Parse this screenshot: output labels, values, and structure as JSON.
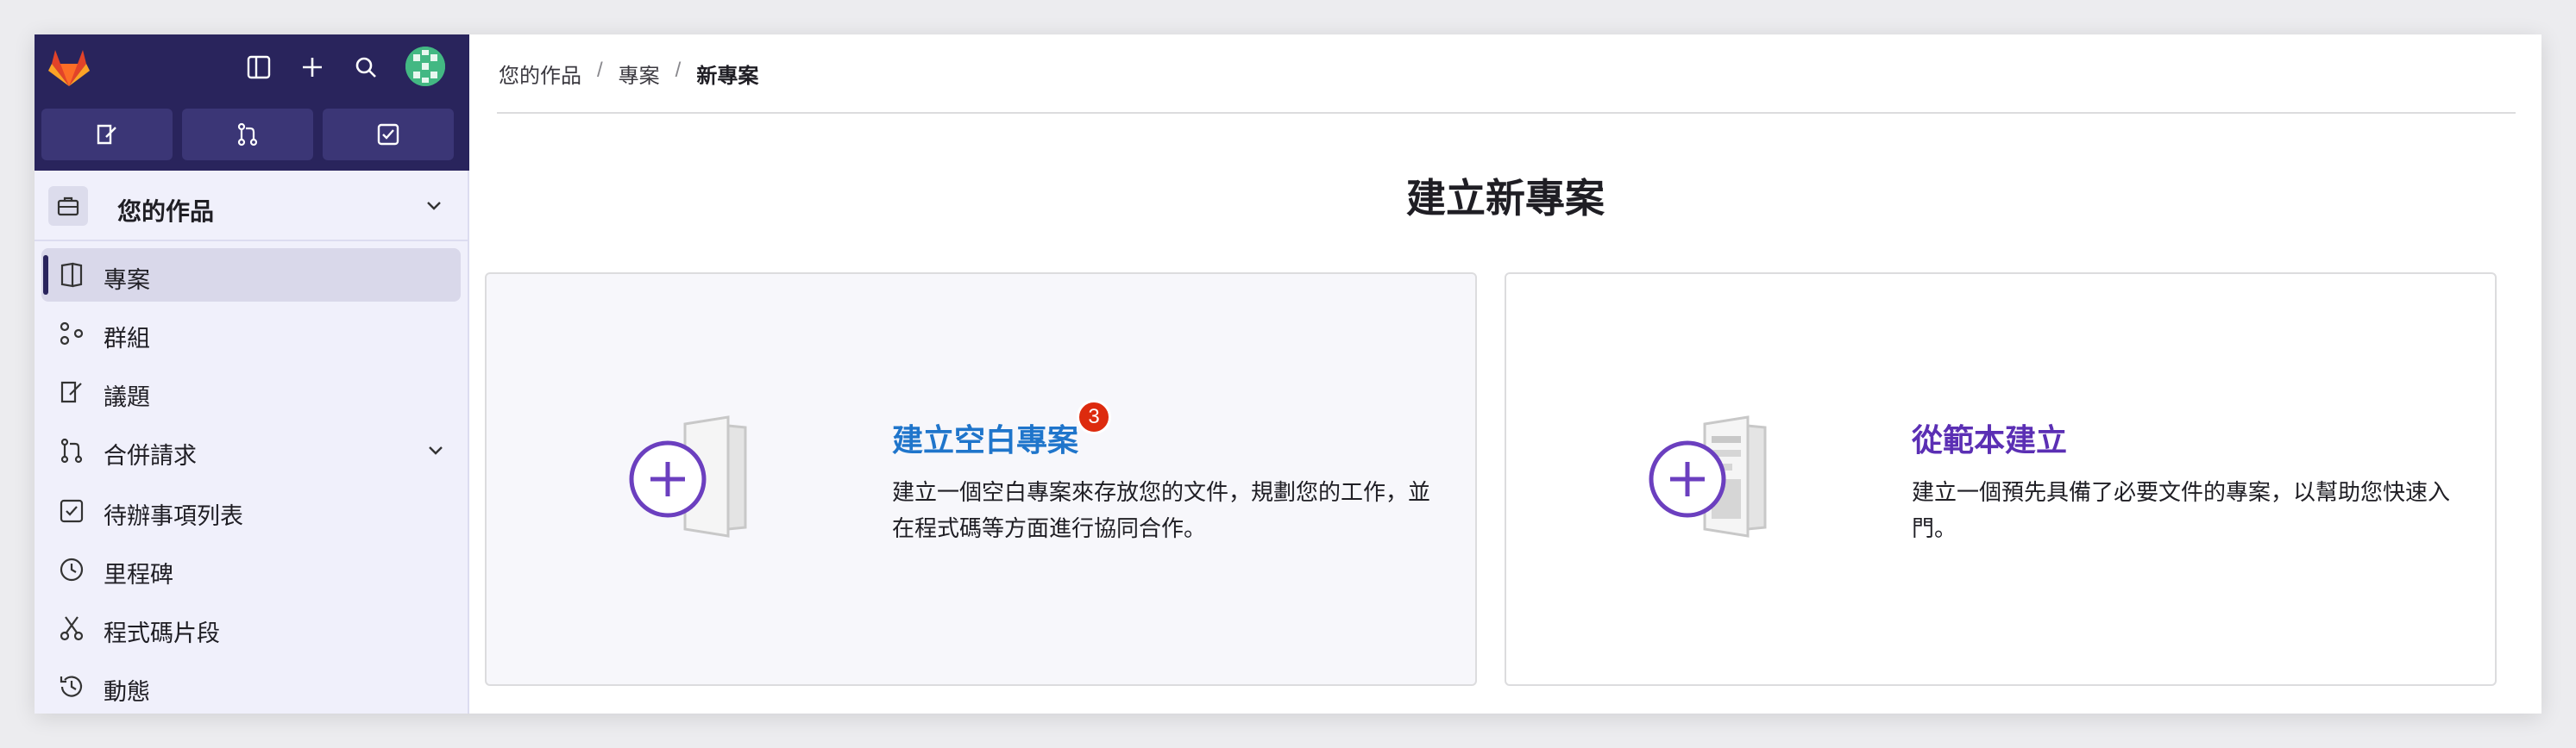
{
  "sidebar": {
    "context_label": "您的作品",
    "items": [
      {
        "label": "專案",
        "icon": "project-icon"
      },
      {
        "label": "群組",
        "icon": "group-icon"
      },
      {
        "label": "議題",
        "icon": "issues-icon"
      },
      {
        "label": "合併請求",
        "icon": "merge-request-icon"
      },
      {
        "label": "待辦事項列表",
        "icon": "todo-icon"
      },
      {
        "label": "里程碑",
        "icon": "milestone-icon"
      },
      {
        "label": "程式碼片段",
        "icon": "snippet-icon"
      },
      {
        "label": "動態",
        "icon": "activity-icon"
      }
    ]
  },
  "breadcrumb": {
    "item1": "您的作品",
    "item2": "專案",
    "item3": "新專案",
    "separator": "/"
  },
  "main": {
    "title": "建立新專案",
    "cards": [
      {
        "title": "建立空白專案",
        "desc": "建立一個空白專案來存放您的文件，規劃您的工作，並在程式碼等方面進行協同合作。",
        "badge": "3"
      },
      {
        "title": "從範本建立",
        "desc": "建立一個預先具備了必要文件的專案，以幫助您快速入門。"
      }
    ]
  },
  "colors": {
    "topbar": "#29245c",
    "link_blue": "#1f75cb",
    "link_purple": "#5b2fb4",
    "badge_red": "#dd2b0e"
  }
}
